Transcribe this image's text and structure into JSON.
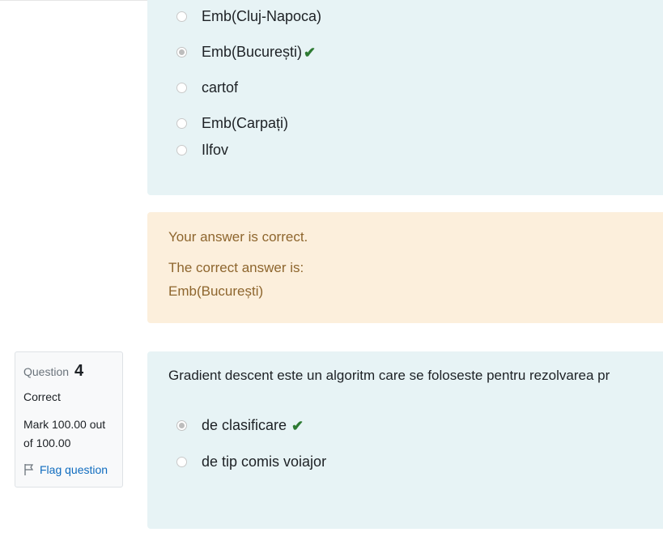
{
  "q3": {
    "options": [
      {
        "label": "Emb(Cluj-Napoca)",
        "selected": false,
        "correct_mark": false
      },
      {
        "label": "Emb(București)",
        "selected": true,
        "correct_mark": true
      },
      {
        "label": "cartof",
        "selected": false,
        "correct_mark": false
      },
      {
        "label": "Emb(Carpați)",
        "selected": false,
        "correct_mark": false
      },
      {
        "label": "Ilfov",
        "selected": false,
        "correct_mark": false
      }
    ]
  },
  "feedback": {
    "result": "Your answer is correct.",
    "correct_label": "The correct answer is:",
    "correct_value": "Emb(București)"
  },
  "q4": {
    "info": {
      "question_label": "Question",
      "number": "4",
      "status": "Correct",
      "mark_line1": "Mark 100.00 out",
      "mark_line2": "of 100.00",
      "flag_label": "Flag question"
    },
    "text": "Gradient descent este un algoritm care se foloseste pentru rezolvarea pr",
    "options": [
      {
        "label": "de clasificare",
        "selected": true,
        "correct_mark": true
      },
      {
        "label": "de tip comis voiajor",
        "selected": false,
        "correct_mark": false
      }
    ]
  },
  "icons": {
    "check": "check-icon",
    "flag": "flag-icon"
  },
  "colors": {
    "answer_bg": "#e7f3f5",
    "feedback_bg": "#fcefdc",
    "feedback_text": "#8e662e",
    "check": "#2d7a32",
    "link": "#0f6cbf"
  }
}
